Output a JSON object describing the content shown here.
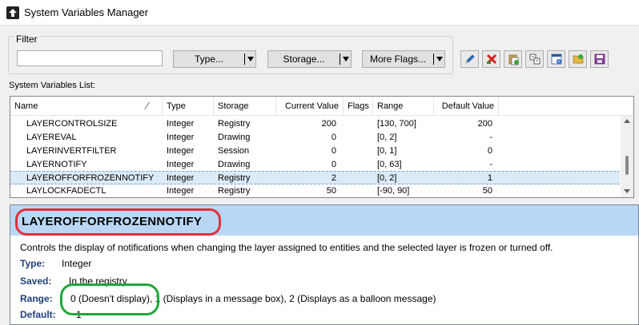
{
  "window": {
    "title": "System Variables Manager",
    "icon": "app-arrow-icon"
  },
  "filter": {
    "group_label": "Filter",
    "search_value": "",
    "type_label": "Type...",
    "storage_label": "Storage...",
    "more_flags_label": "More Flags..."
  },
  "toolbar": {
    "icons": [
      "edit-pencil-icon",
      "delete-x-icon",
      "paste-icon",
      "compare-icon",
      "properties-icon",
      "open-folder-icon",
      "save-disk-icon"
    ]
  },
  "list": {
    "label": "System Variables List:",
    "columns": [
      "Name",
      "Type",
      "Storage",
      "Current Value",
      "Flags",
      "Range",
      "Default Value"
    ],
    "rows": [
      [
        "LAYERCONTROLSIZE",
        "Integer",
        "Registry",
        "200",
        "",
        "[130, 700]",
        "200"
      ],
      [
        "LAYEREVAL",
        "Integer",
        "Drawing",
        "0",
        "",
        "[0, 2]",
        "-"
      ],
      [
        "LAYERINVERTFILTER",
        "Integer",
        "Session",
        "0",
        "",
        "[0, 1]",
        "0"
      ],
      [
        "LAYERNOTIFY",
        "Integer",
        "Drawing",
        "0",
        "",
        "[0, 63]",
        "-"
      ],
      [
        "LAYEROFFORFROZENNOTIFY",
        "Integer",
        "Registry",
        "2",
        "",
        "[0, 2]",
        "1"
      ],
      [
        "LAYLOCKFADECTL",
        "Integer",
        "Registry",
        "50",
        "",
        "[-90, 90]",
        "50"
      ]
    ],
    "selected_index": 4
  },
  "detail": {
    "title": "LAYEROFFORFROZENNOTIFY",
    "description": "Controls the display of notifications when changing the layer assigned to entities and the selected layer is frozen or turned off.",
    "type_label": "Type:",
    "type_value": "Integer",
    "saved_label": "Saved:",
    "saved_value": "In the registry",
    "range_label": "Range:",
    "range_value": "0 (Doesn't display), 1 (Displays in a message box), 2 (Displays as a balloon message)",
    "default_label": "Default:",
    "default_value": "1"
  },
  "colors": {
    "selection": "#dceaf8",
    "detail_header": "#b9d7f5",
    "annotation_red": "#e0303a",
    "annotation_green": "#22a63a",
    "field_label": "#1f3f7a"
  }
}
